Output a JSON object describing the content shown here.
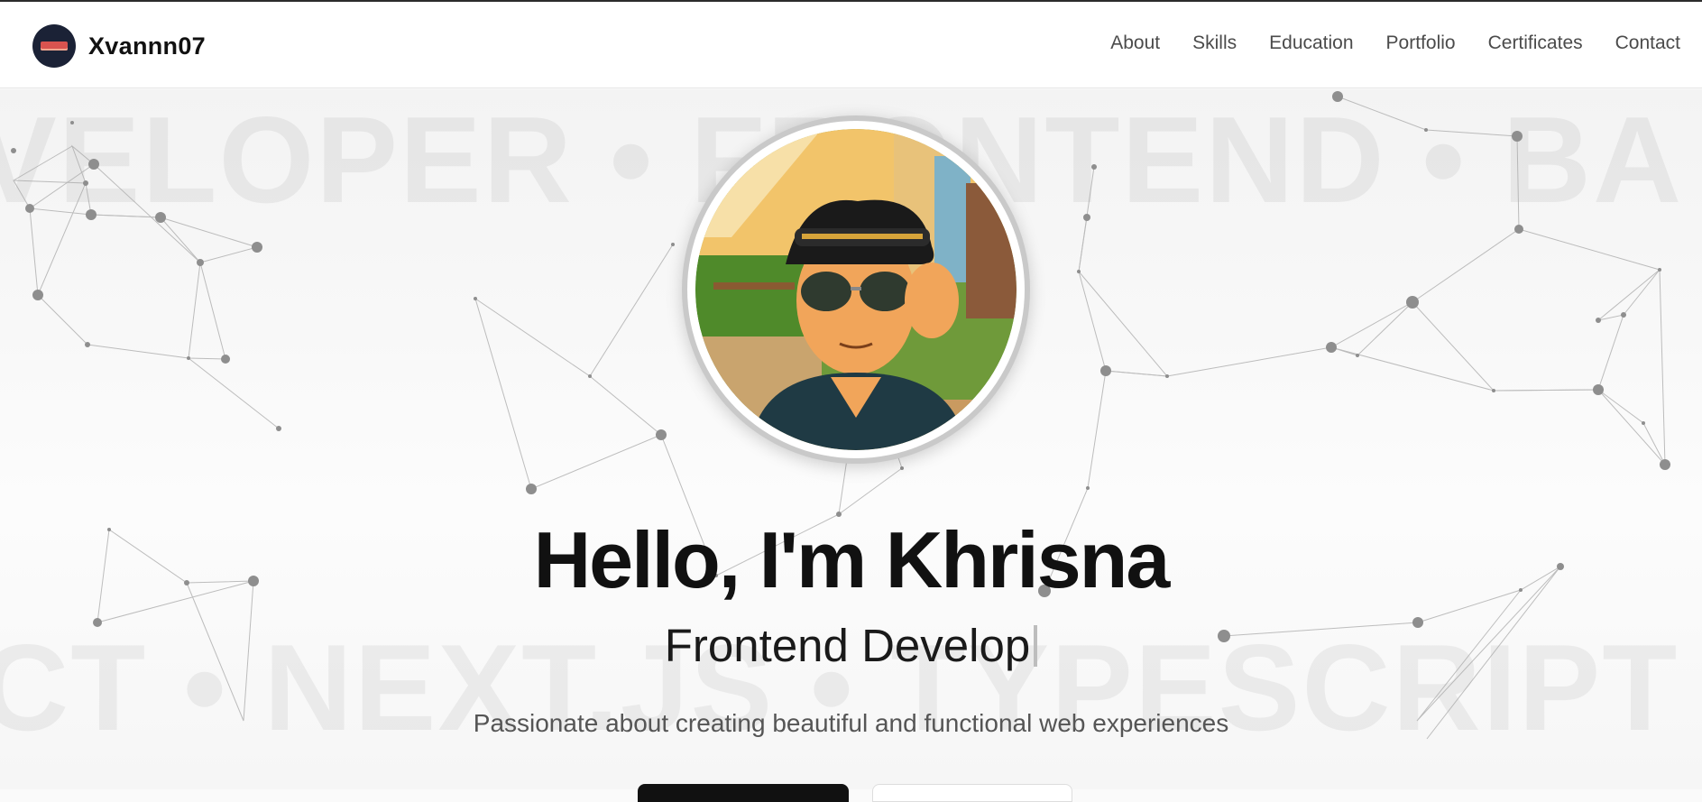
{
  "brand": {
    "name": "Xvannn07",
    "logo_icon": "brand-logo-icon"
  },
  "nav": {
    "items": [
      {
        "label": "About"
      },
      {
        "label": "Skills"
      },
      {
        "label": "Education"
      },
      {
        "label": "Portfolio"
      },
      {
        "label": "Certificates"
      },
      {
        "label": "Contact"
      }
    ]
  },
  "hero": {
    "marquee_top": "VELOPER • FRONTEND • BA",
    "marquee_bottom": "CT • NEXT.JS • TYPESCRIPT",
    "greeting": "Hello, I'm Khrisna",
    "role_typed": "Frontend Develop",
    "tagline": "Passionate about creating beautiful and functional web experiences"
  },
  "colors": {
    "accent": "#111111",
    "nav_text": "#4b4b4b",
    "network": "#9a9a9a"
  }
}
